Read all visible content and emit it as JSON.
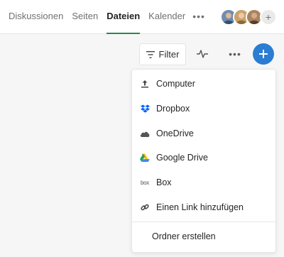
{
  "tabs": [
    {
      "label": "Diskussionen",
      "active": false
    },
    {
      "label": "Seiten",
      "active": false
    },
    {
      "label": "Dateien",
      "active": true
    },
    {
      "label": "Kalender",
      "active": false
    }
  ],
  "tab_more": "•••",
  "avatar_add": "+",
  "toolbar": {
    "filter_label": "Filter",
    "more_label": "•••",
    "add_label": "+"
  },
  "menu": {
    "items": [
      {
        "label": "Computer",
        "icon": "upload-icon"
      },
      {
        "label": "Dropbox",
        "icon": "dropbox-icon"
      },
      {
        "label": "OneDrive",
        "icon": "onedrive-icon"
      },
      {
        "label": "Google Drive",
        "icon": "google-drive-icon"
      },
      {
        "label": "Box",
        "icon": "box-icon"
      },
      {
        "label": "Einen Link hinzufügen",
        "icon": "link-icon"
      }
    ],
    "create_folder_label": "Ordner erstellen",
    "box_logo_text": "box"
  },
  "colors": {
    "accent_tab": "#2a8a4a",
    "fab": "#2b7cd3",
    "dropbox": "#0061fe"
  }
}
